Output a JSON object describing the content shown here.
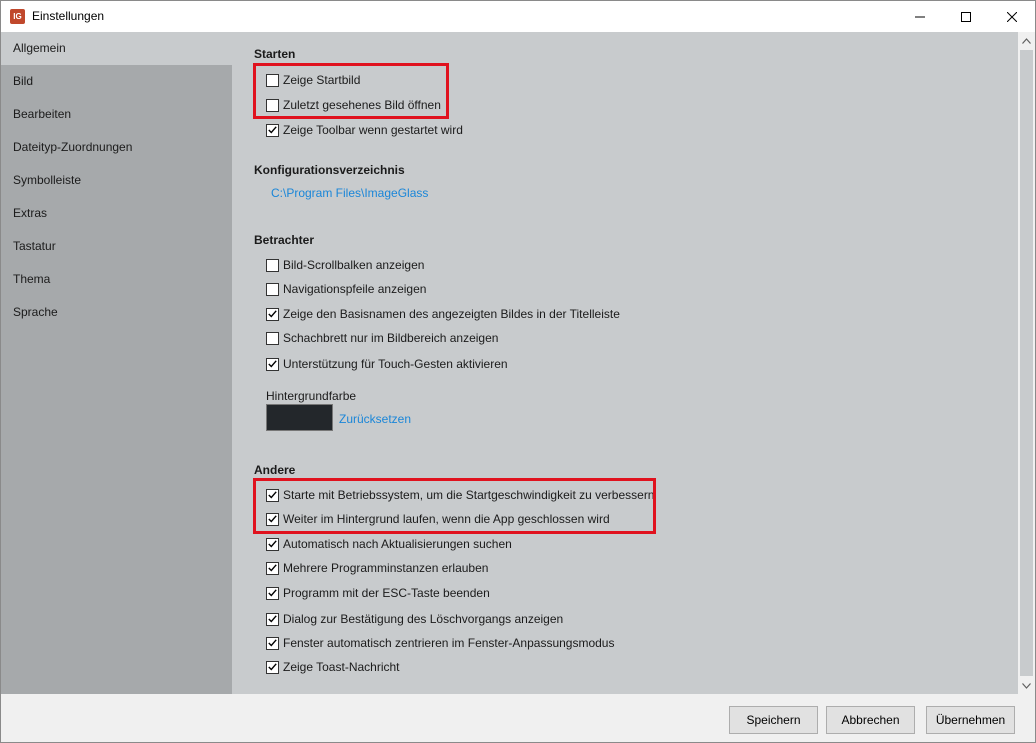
{
  "window": {
    "title": "Einstellungen",
    "app_icon_text": "IG"
  },
  "sidebar": {
    "items": [
      {
        "label": "Allgemein",
        "active": true
      },
      {
        "label": "Bild"
      },
      {
        "label": "Bearbeiten"
      },
      {
        "label": "Dateityp-Zuordnungen"
      },
      {
        "label": "Symbolleiste"
      },
      {
        "label": "Extras"
      },
      {
        "label": "Tastatur"
      },
      {
        "label": "Thema"
      },
      {
        "label": "Sprache"
      }
    ]
  },
  "sections": {
    "starten": {
      "title": "Starten",
      "options": [
        {
          "label": "Zeige Startbild",
          "checked": false
        },
        {
          "label": "Zuletzt gesehenes Bild öffnen",
          "checked": false
        },
        {
          "label": "Zeige Toolbar wenn gestartet wird",
          "checked": true
        }
      ]
    },
    "config": {
      "title": "Konfigurationsverzeichnis",
      "path": "C:\\Program Files\\ImageGlass"
    },
    "betrachter": {
      "title": "Betrachter",
      "options": [
        {
          "label": "Bild-Scrollbalken anzeigen",
          "checked": false
        },
        {
          "label": "Navigationspfeile anzeigen",
          "checked": false
        },
        {
          "label": "Zeige den Basisnamen des angezeigten Bildes in der Titelleiste",
          "checked": true
        },
        {
          "label": "Schachbrett nur im Bildbereich anzeigen",
          "checked": false
        },
        {
          "label": "Unterstützung für Touch-Gesten aktivieren",
          "checked": true
        }
      ],
      "background_label": "Hintergrundfarbe",
      "background_color": "#23272b",
      "reset_label": "Zurücksetzen"
    },
    "andere": {
      "title": "Andere",
      "options": [
        {
          "label": "Starte mit Betriebssystem, um die Startgeschwindigkeit zu verbessern",
          "checked": true
        },
        {
          "label": "Weiter im Hintergrund laufen, wenn die App geschlossen wird",
          "checked": true
        },
        {
          "label": "Automatisch nach Aktualisierungen suchen",
          "checked": true
        },
        {
          "label": "Mehrere Programminstanzen erlauben",
          "checked": true
        },
        {
          "label": "Programm mit der ESC-Taste beenden",
          "checked": true
        },
        {
          "label": "Dialog zur Bestätigung des Löschvorgangs anzeigen",
          "checked": true
        },
        {
          "label": "Fenster automatisch zentrieren im Fenster-Anpassungsmodus",
          "checked": true
        },
        {
          "label": "Zeige Toast-Nachricht",
          "checked": true
        }
      ]
    }
  },
  "footer": {
    "save_label": "Speichern",
    "cancel_label": "Abbrechen",
    "apply_label": "Übernehmen"
  },
  "colors": {
    "sidebar_bg": "#a6a9ab",
    "content_bg": "#c8cbcd",
    "link": "#1a86d8",
    "highlight": "#e0121e"
  }
}
